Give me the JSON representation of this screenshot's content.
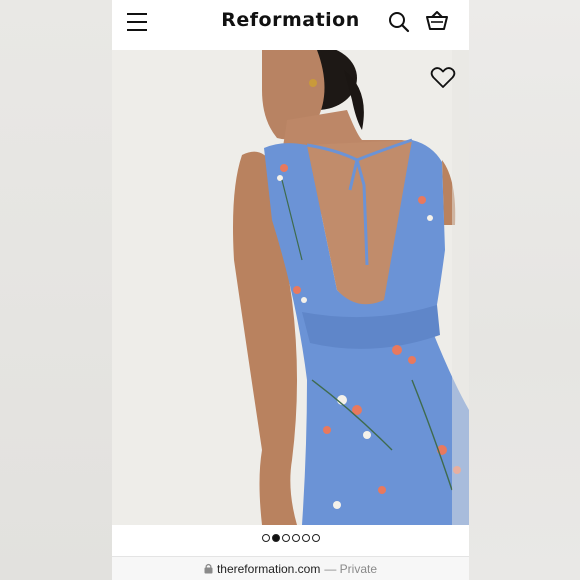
{
  "header": {
    "brand": "Reformation",
    "menu_icon": "hamburger-menu-icon",
    "search_icon": "search-icon",
    "cart_icon": "shopping-basket-icon"
  },
  "product": {
    "wishlist_icon": "heart-outline-icon",
    "dress_color": "#6b93d6"
  },
  "carousel": {
    "total": 6,
    "active_index": 1
  },
  "address_bar": {
    "lock_icon": "lock-icon",
    "domain": "thereformation.com",
    "suffix": "— Private"
  }
}
